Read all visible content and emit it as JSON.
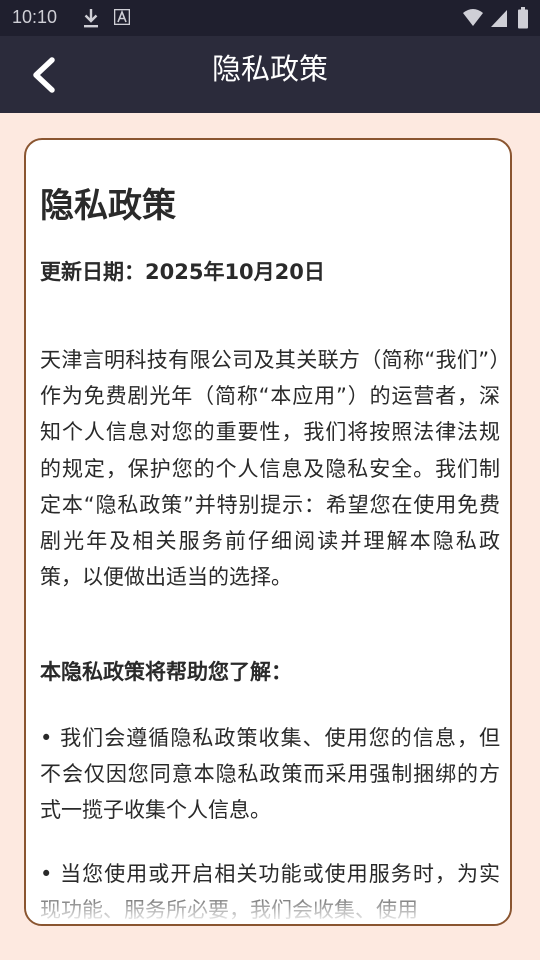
{
  "status_bar": {
    "time": "10:10",
    "icons": [
      "download-icon",
      "a-icon",
      "wifi-icon",
      "signal-icon",
      "battery-icon"
    ]
  },
  "title_bar": {
    "title": "隐私政策",
    "back_icon": "chevron-left-icon",
    "background": "#2b2b3b"
  },
  "document": {
    "heading": "隐私政策",
    "update_date": "更新日期：2025年10月20日",
    "intro": "天津言明科技有限公司及其关联方（简称“我们”）作为免费剧光年（简称“本应用”）的运营者，深知个人信息对您的重要性，我们将按照法律法规的规定，保护您的个人信息及隐私安全。我们制定本“隐私政策”并特别提示：希望您在使用免费剧光年及相关服务前仔细阅读并理解本隐私政策，以便做出适当的选择。",
    "section_heading": "本隐私政策将帮助您了解：",
    "bullets": [
      "• 我们会遵循隐私政策收集、使用您的信息，但不会仅因您同意本隐私政策而采用强制捆绑的方式一揽子收集个人信息。",
      "• 当您使用或开启相关功能或使用服务时，为实现功能、服务所必要，我们会收集、使用"
    ]
  },
  "colors": {
    "page_background": "#fde9e0",
    "card_border": "#8a5530",
    "text": "#2a2a2a",
    "status_bar": "#1f1f2e"
  }
}
